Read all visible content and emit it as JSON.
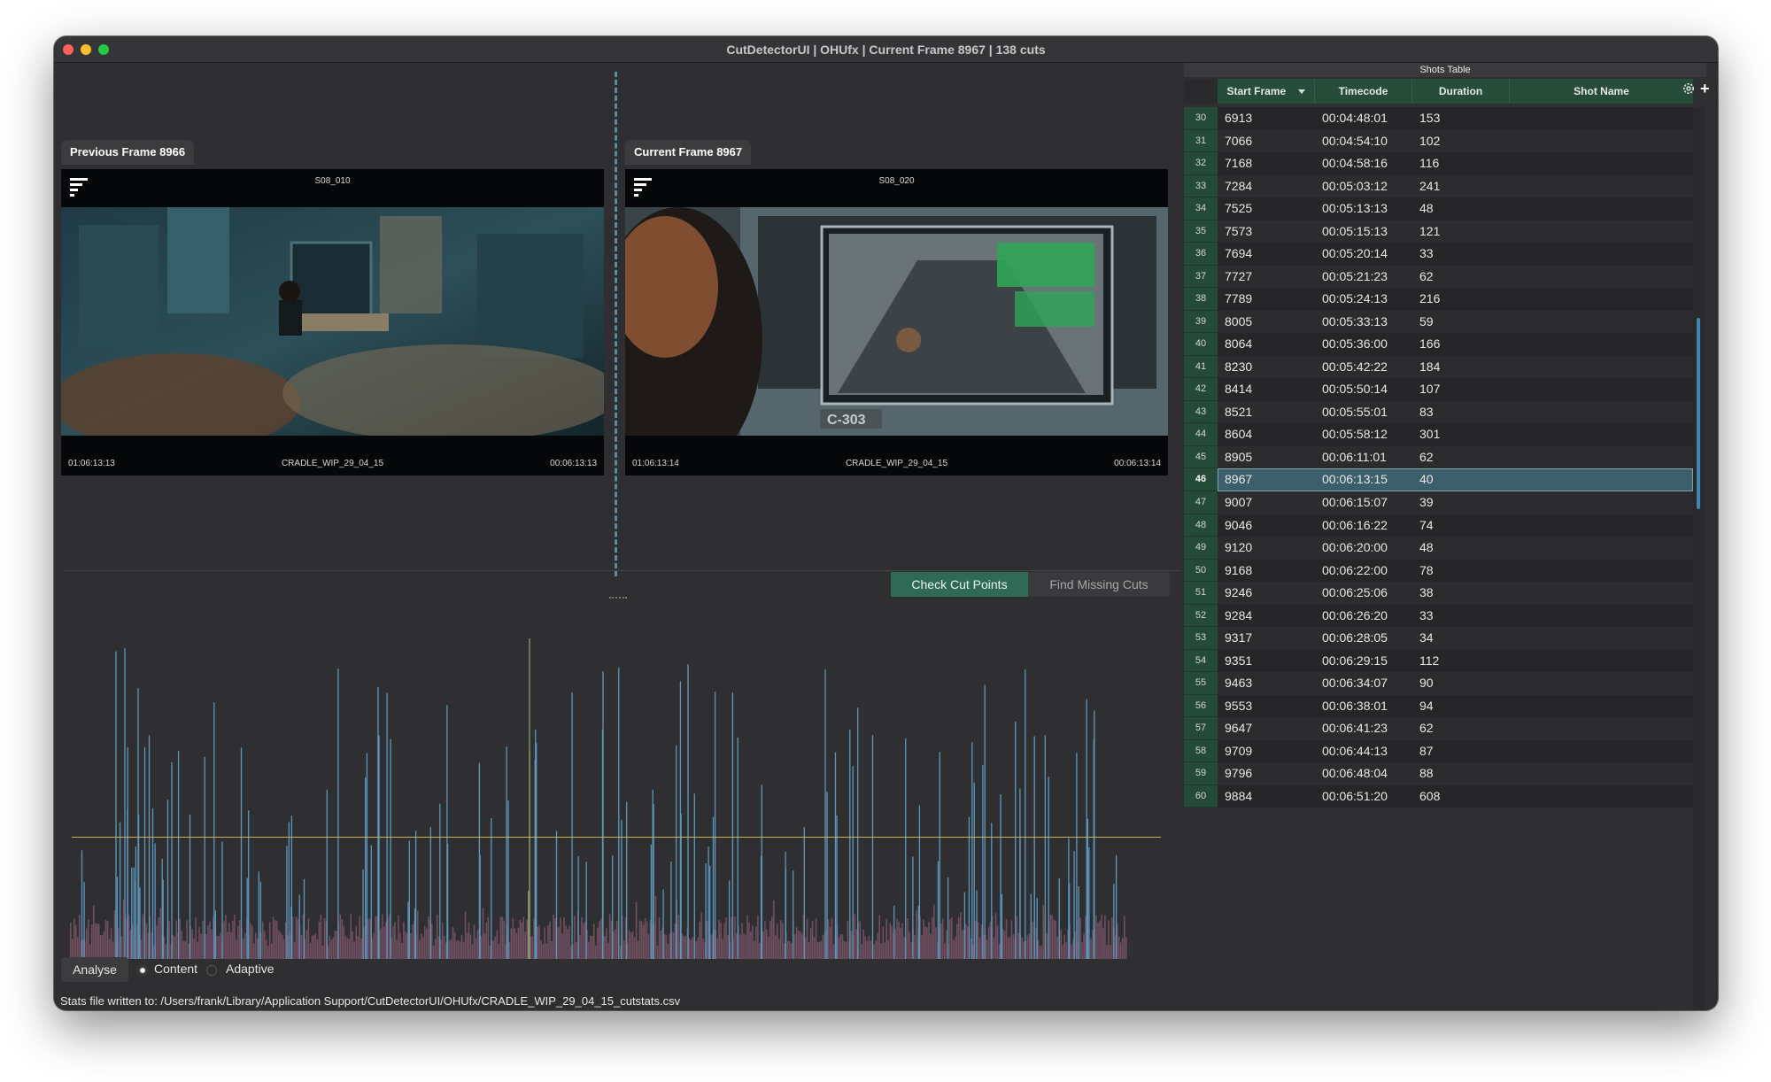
{
  "window": {
    "title": "CutDetectorUI | OHUfx   |   Current Frame 8967   |   138 cuts",
    "traffic_lights": {
      "close": "#ff5f57",
      "minimize": "#febc2e",
      "zoom": "#28c840"
    }
  },
  "previous_frame": {
    "label": "Previous Frame 8966",
    "shot": "S08_010",
    "tc_left": "01:06:13:13",
    "clip": "CRADLE_WIP_29_04_15",
    "tc_right": "00:06:13:13"
  },
  "current_frame": {
    "label": "Current Frame 8967",
    "shot": "S08_020",
    "tc_left": "01:06:13:14",
    "clip": "CRADLE_WIP_29_04_15",
    "tc_right": "00:06:13:14"
  },
  "toolbar": {
    "check_cut_points": "Check Cut Points",
    "find_missing_cuts": "Find Missing Cuts"
  },
  "chart_data": {
    "type": "bar",
    "title": "",
    "xlabel": "",
    "ylabel": "",
    "threshold": 0.38,
    "ylim": [
      0,
      1
    ],
    "colors": {
      "cut": "#5d97bd",
      "content": "#6f4f60",
      "threshold": "#c8b45a",
      "tall": "#8a9a6a"
    }
  },
  "bottom": {
    "analyse_label": "Analyse",
    "mode_content": "Content",
    "mode_adaptive": "Adaptive",
    "status": "Stats file written to: /Users/frank/Library/Application Support/CutDetectorUI/OHUfx/CRADLE_WIP_29_04_15_cutstats.csv"
  },
  "shots_table": {
    "title": "Shots Table",
    "columns": [
      "Start Frame",
      "Timecode",
      "Duration",
      "Shot Name"
    ],
    "sort_icon": "sort-desc-icon",
    "selected_index": "46",
    "rows": [
      {
        "idx": "30",
        "start": "6913",
        "tc": "00:04:48:01",
        "dur": "153",
        "name": ""
      },
      {
        "idx": "31",
        "start": "7066",
        "tc": "00:04:54:10",
        "dur": "102",
        "name": ""
      },
      {
        "idx": "32",
        "start": "7168",
        "tc": "00:04:58:16",
        "dur": "116",
        "name": ""
      },
      {
        "idx": "33",
        "start": "7284",
        "tc": "00:05:03:12",
        "dur": "241",
        "name": ""
      },
      {
        "idx": "34",
        "start": "7525",
        "tc": "00:05:13:13",
        "dur": "48",
        "name": ""
      },
      {
        "idx": "35",
        "start": "7573",
        "tc": "00:05:15:13",
        "dur": "121",
        "name": ""
      },
      {
        "idx": "36",
        "start": "7694",
        "tc": "00:05:20:14",
        "dur": "33",
        "name": ""
      },
      {
        "idx": "37",
        "start": "7727",
        "tc": "00:05:21:23",
        "dur": "62",
        "name": ""
      },
      {
        "idx": "38",
        "start": "7789",
        "tc": "00:05:24:13",
        "dur": "216",
        "name": ""
      },
      {
        "idx": "39",
        "start": "8005",
        "tc": "00:05:33:13",
        "dur": "59",
        "name": ""
      },
      {
        "idx": "40",
        "start": "8064",
        "tc": "00:05:36:00",
        "dur": "166",
        "name": ""
      },
      {
        "idx": "41",
        "start": "8230",
        "tc": "00:05:42:22",
        "dur": "184",
        "name": ""
      },
      {
        "idx": "42",
        "start": "8414",
        "tc": "00:05:50:14",
        "dur": "107",
        "name": ""
      },
      {
        "idx": "43",
        "start": "8521",
        "tc": "00:05:55:01",
        "dur": "83",
        "name": ""
      },
      {
        "idx": "44",
        "start": "8604",
        "tc": "00:05:58:12",
        "dur": "301",
        "name": ""
      },
      {
        "idx": "45",
        "start": "8905",
        "tc": "00:06:11:01",
        "dur": "62",
        "name": ""
      },
      {
        "idx": "46",
        "start": "8967",
        "tc": "00:06:13:15",
        "dur": "40",
        "name": ""
      },
      {
        "idx": "47",
        "start": "9007",
        "tc": "00:06:15:07",
        "dur": "39",
        "name": ""
      },
      {
        "idx": "48",
        "start": "9046",
        "tc": "00:06:16:22",
        "dur": "74",
        "name": ""
      },
      {
        "idx": "49",
        "start": "9120",
        "tc": "00:06:20:00",
        "dur": "48",
        "name": ""
      },
      {
        "idx": "50",
        "start": "9168",
        "tc": "00:06:22:00",
        "dur": "78",
        "name": ""
      },
      {
        "idx": "51",
        "start": "9246",
        "tc": "00:06:25:06",
        "dur": "38",
        "name": ""
      },
      {
        "idx": "52",
        "start": "9284",
        "tc": "00:06:26:20",
        "dur": "33",
        "name": ""
      },
      {
        "idx": "53",
        "start": "9317",
        "tc": "00:06:28:05",
        "dur": "34",
        "name": ""
      },
      {
        "idx": "54",
        "start": "9351",
        "tc": "00:06:29:15",
        "dur": "112",
        "name": ""
      },
      {
        "idx": "55",
        "start": "9463",
        "tc": "00:06:34:07",
        "dur": "90",
        "name": ""
      },
      {
        "idx": "56",
        "start": "9553",
        "tc": "00:06:38:01",
        "dur": "94",
        "name": ""
      },
      {
        "idx": "57",
        "start": "9647",
        "tc": "00:06:41:23",
        "dur": "62",
        "name": ""
      },
      {
        "idx": "58",
        "start": "9709",
        "tc": "00:06:44:13",
        "dur": "87",
        "name": ""
      },
      {
        "idx": "59",
        "start": "9796",
        "tc": "00:06:48:04",
        "dur": "88",
        "name": ""
      },
      {
        "idx": "60",
        "start": "9884",
        "tc": "00:06:51:20",
        "dur": "608",
        "name": ""
      }
    ]
  }
}
